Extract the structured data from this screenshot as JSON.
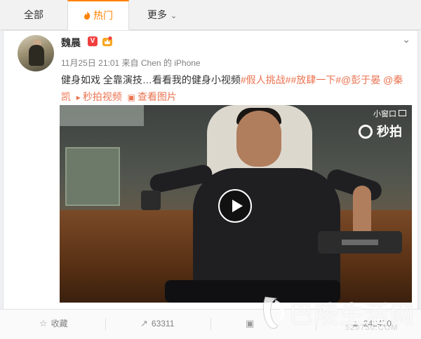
{
  "tabs": [
    {
      "label": "全部"
    },
    {
      "label": "热门"
    },
    {
      "label": "更多"
    }
  ],
  "post": {
    "author": "魏晨",
    "verified_badge": "V",
    "date": "11月25日 21:01",
    "source_prefix": "来自",
    "source": "Chen 的 iPhone",
    "text_plain": "健身如戏 全靠演技…看看我的健身小视频",
    "hashtag1": "#假人挑战#",
    "hashtag2": "#放肆一下#",
    "mention1": "@彭于晏",
    "mention2": "@秦凯",
    "link_video": "秒拍视频",
    "link_pictures": "查看图片"
  },
  "video": {
    "mini_window": "小窗口",
    "brand": "秒拍"
  },
  "actions": {
    "favorite": "收藏",
    "repost_count": "63311",
    "comment_count": "",
    "like_count": "242470"
  },
  "watermark": {
    "text": "巴陵生活网",
    "url": "520730.COM"
  }
}
